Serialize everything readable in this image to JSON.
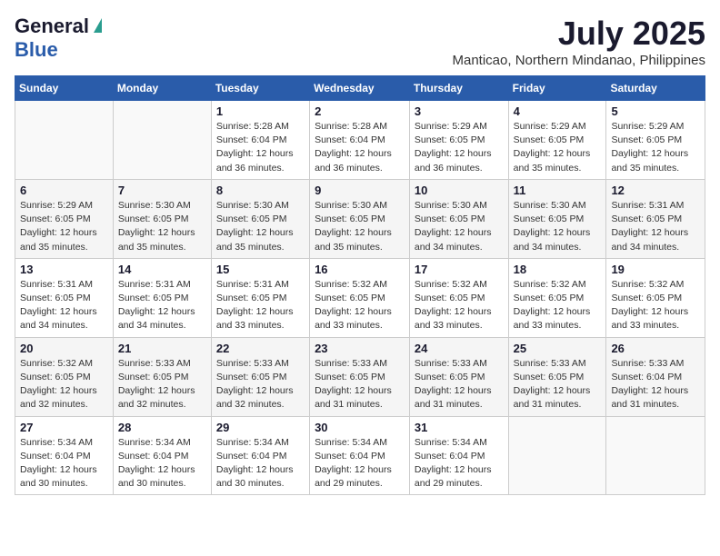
{
  "header": {
    "logo_general": "General",
    "logo_blue": "Blue",
    "month": "July 2025",
    "location": "Manticao, Northern Mindanao, Philippines"
  },
  "weekdays": [
    "Sunday",
    "Monday",
    "Tuesday",
    "Wednesday",
    "Thursday",
    "Friday",
    "Saturday"
  ],
  "weeks": [
    [
      {
        "day": "",
        "sunrise": "",
        "sunset": "",
        "daylight": ""
      },
      {
        "day": "",
        "sunrise": "",
        "sunset": "",
        "daylight": ""
      },
      {
        "day": "1",
        "sunrise": "Sunrise: 5:28 AM",
        "sunset": "Sunset: 6:04 PM",
        "daylight": "Daylight: 12 hours and 36 minutes."
      },
      {
        "day": "2",
        "sunrise": "Sunrise: 5:28 AM",
        "sunset": "Sunset: 6:04 PM",
        "daylight": "Daylight: 12 hours and 36 minutes."
      },
      {
        "day": "3",
        "sunrise": "Sunrise: 5:29 AM",
        "sunset": "Sunset: 6:05 PM",
        "daylight": "Daylight: 12 hours and 36 minutes."
      },
      {
        "day": "4",
        "sunrise": "Sunrise: 5:29 AM",
        "sunset": "Sunset: 6:05 PM",
        "daylight": "Daylight: 12 hours and 35 minutes."
      },
      {
        "day": "5",
        "sunrise": "Sunrise: 5:29 AM",
        "sunset": "Sunset: 6:05 PM",
        "daylight": "Daylight: 12 hours and 35 minutes."
      }
    ],
    [
      {
        "day": "6",
        "sunrise": "Sunrise: 5:29 AM",
        "sunset": "Sunset: 6:05 PM",
        "daylight": "Daylight: 12 hours and 35 minutes."
      },
      {
        "day": "7",
        "sunrise": "Sunrise: 5:30 AM",
        "sunset": "Sunset: 6:05 PM",
        "daylight": "Daylight: 12 hours and 35 minutes."
      },
      {
        "day": "8",
        "sunrise": "Sunrise: 5:30 AM",
        "sunset": "Sunset: 6:05 PM",
        "daylight": "Daylight: 12 hours and 35 minutes."
      },
      {
        "day": "9",
        "sunrise": "Sunrise: 5:30 AM",
        "sunset": "Sunset: 6:05 PM",
        "daylight": "Daylight: 12 hours and 35 minutes."
      },
      {
        "day": "10",
        "sunrise": "Sunrise: 5:30 AM",
        "sunset": "Sunset: 6:05 PM",
        "daylight": "Daylight: 12 hours and 34 minutes."
      },
      {
        "day": "11",
        "sunrise": "Sunrise: 5:30 AM",
        "sunset": "Sunset: 6:05 PM",
        "daylight": "Daylight: 12 hours and 34 minutes."
      },
      {
        "day": "12",
        "sunrise": "Sunrise: 5:31 AM",
        "sunset": "Sunset: 6:05 PM",
        "daylight": "Daylight: 12 hours and 34 minutes."
      }
    ],
    [
      {
        "day": "13",
        "sunrise": "Sunrise: 5:31 AM",
        "sunset": "Sunset: 6:05 PM",
        "daylight": "Daylight: 12 hours and 34 minutes."
      },
      {
        "day": "14",
        "sunrise": "Sunrise: 5:31 AM",
        "sunset": "Sunset: 6:05 PM",
        "daylight": "Daylight: 12 hours and 34 minutes."
      },
      {
        "day": "15",
        "sunrise": "Sunrise: 5:31 AM",
        "sunset": "Sunset: 6:05 PM",
        "daylight": "Daylight: 12 hours and 33 minutes."
      },
      {
        "day": "16",
        "sunrise": "Sunrise: 5:32 AM",
        "sunset": "Sunset: 6:05 PM",
        "daylight": "Daylight: 12 hours and 33 minutes."
      },
      {
        "day": "17",
        "sunrise": "Sunrise: 5:32 AM",
        "sunset": "Sunset: 6:05 PM",
        "daylight": "Daylight: 12 hours and 33 minutes."
      },
      {
        "day": "18",
        "sunrise": "Sunrise: 5:32 AM",
        "sunset": "Sunset: 6:05 PM",
        "daylight": "Daylight: 12 hours and 33 minutes."
      },
      {
        "day": "19",
        "sunrise": "Sunrise: 5:32 AM",
        "sunset": "Sunset: 6:05 PM",
        "daylight": "Daylight: 12 hours and 33 minutes."
      }
    ],
    [
      {
        "day": "20",
        "sunrise": "Sunrise: 5:32 AM",
        "sunset": "Sunset: 6:05 PM",
        "daylight": "Daylight: 12 hours and 32 minutes."
      },
      {
        "day": "21",
        "sunrise": "Sunrise: 5:33 AM",
        "sunset": "Sunset: 6:05 PM",
        "daylight": "Daylight: 12 hours and 32 minutes."
      },
      {
        "day": "22",
        "sunrise": "Sunrise: 5:33 AM",
        "sunset": "Sunset: 6:05 PM",
        "daylight": "Daylight: 12 hours and 32 minutes."
      },
      {
        "day": "23",
        "sunrise": "Sunrise: 5:33 AM",
        "sunset": "Sunset: 6:05 PM",
        "daylight": "Daylight: 12 hours and 31 minutes."
      },
      {
        "day": "24",
        "sunrise": "Sunrise: 5:33 AM",
        "sunset": "Sunset: 6:05 PM",
        "daylight": "Daylight: 12 hours and 31 minutes."
      },
      {
        "day": "25",
        "sunrise": "Sunrise: 5:33 AM",
        "sunset": "Sunset: 6:05 PM",
        "daylight": "Daylight: 12 hours and 31 minutes."
      },
      {
        "day": "26",
        "sunrise": "Sunrise: 5:33 AM",
        "sunset": "Sunset: 6:04 PM",
        "daylight": "Daylight: 12 hours and 31 minutes."
      }
    ],
    [
      {
        "day": "27",
        "sunrise": "Sunrise: 5:34 AM",
        "sunset": "Sunset: 6:04 PM",
        "daylight": "Daylight: 12 hours and 30 minutes."
      },
      {
        "day": "28",
        "sunrise": "Sunrise: 5:34 AM",
        "sunset": "Sunset: 6:04 PM",
        "daylight": "Daylight: 12 hours and 30 minutes."
      },
      {
        "day": "29",
        "sunrise": "Sunrise: 5:34 AM",
        "sunset": "Sunset: 6:04 PM",
        "daylight": "Daylight: 12 hours and 30 minutes."
      },
      {
        "day": "30",
        "sunrise": "Sunrise: 5:34 AM",
        "sunset": "Sunset: 6:04 PM",
        "daylight": "Daylight: 12 hours and 29 minutes."
      },
      {
        "day": "31",
        "sunrise": "Sunrise: 5:34 AM",
        "sunset": "Sunset: 6:04 PM",
        "daylight": "Daylight: 12 hours and 29 minutes."
      },
      {
        "day": "",
        "sunrise": "",
        "sunset": "",
        "daylight": ""
      },
      {
        "day": "",
        "sunrise": "",
        "sunset": "",
        "daylight": ""
      }
    ]
  ]
}
